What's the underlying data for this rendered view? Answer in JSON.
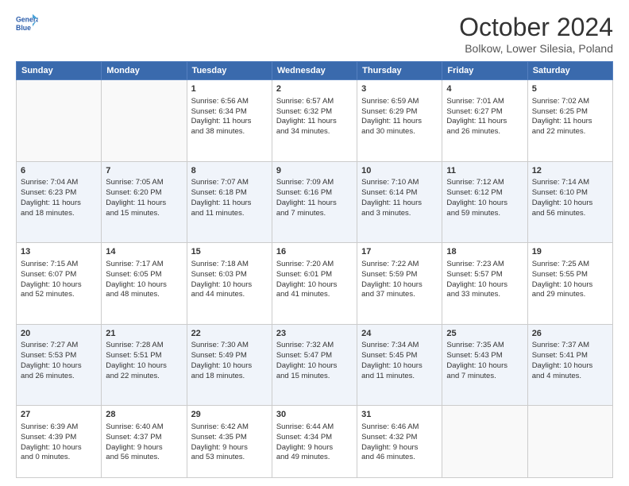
{
  "logo": {
    "line1": "General",
    "line2": "Blue"
  },
  "title": "October 2024",
  "subtitle": "Bolkow, Lower Silesia, Poland",
  "days_header": [
    "Sunday",
    "Monday",
    "Tuesday",
    "Wednesday",
    "Thursday",
    "Friday",
    "Saturday"
  ],
  "weeks": [
    [
      {
        "num": "",
        "info": ""
      },
      {
        "num": "",
        "info": ""
      },
      {
        "num": "1",
        "info": "Sunrise: 6:56 AM\nSunset: 6:34 PM\nDaylight: 11 hours\nand 38 minutes."
      },
      {
        "num": "2",
        "info": "Sunrise: 6:57 AM\nSunset: 6:32 PM\nDaylight: 11 hours\nand 34 minutes."
      },
      {
        "num": "3",
        "info": "Sunrise: 6:59 AM\nSunset: 6:29 PM\nDaylight: 11 hours\nand 30 minutes."
      },
      {
        "num": "4",
        "info": "Sunrise: 7:01 AM\nSunset: 6:27 PM\nDaylight: 11 hours\nand 26 minutes."
      },
      {
        "num": "5",
        "info": "Sunrise: 7:02 AM\nSunset: 6:25 PM\nDaylight: 11 hours\nand 22 minutes."
      }
    ],
    [
      {
        "num": "6",
        "info": "Sunrise: 7:04 AM\nSunset: 6:23 PM\nDaylight: 11 hours\nand 18 minutes."
      },
      {
        "num": "7",
        "info": "Sunrise: 7:05 AM\nSunset: 6:20 PM\nDaylight: 11 hours\nand 15 minutes."
      },
      {
        "num": "8",
        "info": "Sunrise: 7:07 AM\nSunset: 6:18 PM\nDaylight: 11 hours\nand 11 minutes."
      },
      {
        "num": "9",
        "info": "Sunrise: 7:09 AM\nSunset: 6:16 PM\nDaylight: 11 hours\nand 7 minutes."
      },
      {
        "num": "10",
        "info": "Sunrise: 7:10 AM\nSunset: 6:14 PM\nDaylight: 11 hours\nand 3 minutes."
      },
      {
        "num": "11",
        "info": "Sunrise: 7:12 AM\nSunset: 6:12 PM\nDaylight: 10 hours\nand 59 minutes."
      },
      {
        "num": "12",
        "info": "Sunrise: 7:14 AM\nSunset: 6:10 PM\nDaylight: 10 hours\nand 56 minutes."
      }
    ],
    [
      {
        "num": "13",
        "info": "Sunrise: 7:15 AM\nSunset: 6:07 PM\nDaylight: 10 hours\nand 52 minutes."
      },
      {
        "num": "14",
        "info": "Sunrise: 7:17 AM\nSunset: 6:05 PM\nDaylight: 10 hours\nand 48 minutes."
      },
      {
        "num": "15",
        "info": "Sunrise: 7:18 AM\nSunset: 6:03 PM\nDaylight: 10 hours\nand 44 minutes."
      },
      {
        "num": "16",
        "info": "Sunrise: 7:20 AM\nSunset: 6:01 PM\nDaylight: 10 hours\nand 41 minutes."
      },
      {
        "num": "17",
        "info": "Sunrise: 7:22 AM\nSunset: 5:59 PM\nDaylight: 10 hours\nand 37 minutes."
      },
      {
        "num": "18",
        "info": "Sunrise: 7:23 AM\nSunset: 5:57 PM\nDaylight: 10 hours\nand 33 minutes."
      },
      {
        "num": "19",
        "info": "Sunrise: 7:25 AM\nSunset: 5:55 PM\nDaylight: 10 hours\nand 29 minutes."
      }
    ],
    [
      {
        "num": "20",
        "info": "Sunrise: 7:27 AM\nSunset: 5:53 PM\nDaylight: 10 hours\nand 26 minutes."
      },
      {
        "num": "21",
        "info": "Sunrise: 7:28 AM\nSunset: 5:51 PM\nDaylight: 10 hours\nand 22 minutes."
      },
      {
        "num": "22",
        "info": "Sunrise: 7:30 AM\nSunset: 5:49 PM\nDaylight: 10 hours\nand 18 minutes."
      },
      {
        "num": "23",
        "info": "Sunrise: 7:32 AM\nSunset: 5:47 PM\nDaylight: 10 hours\nand 15 minutes."
      },
      {
        "num": "24",
        "info": "Sunrise: 7:34 AM\nSunset: 5:45 PM\nDaylight: 10 hours\nand 11 minutes."
      },
      {
        "num": "25",
        "info": "Sunrise: 7:35 AM\nSunset: 5:43 PM\nDaylight: 10 hours\nand 7 minutes."
      },
      {
        "num": "26",
        "info": "Sunrise: 7:37 AM\nSunset: 5:41 PM\nDaylight: 10 hours\nand 4 minutes."
      }
    ],
    [
      {
        "num": "27",
        "info": "Sunrise: 6:39 AM\nSunset: 4:39 PM\nDaylight: 10 hours\nand 0 minutes."
      },
      {
        "num": "28",
        "info": "Sunrise: 6:40 AM\nSunset: 4:37 PM\nDaylight: 9 hours\nand 56 minutes."
      },
      {
        "num": "29",
        "info": "Sunrise: 6:42 AM\nSunset: 4:35 PM\nDaylight: 9 hours\nand 53 minutes."
      },
      {
        "num": "30",
        "info": "Sunrise: 6:44 AM\nSunset: 4:34 PM\nDaylight: 9 hours\nand 49 minutes."
      },
      {
        "num": "31",
        "info": "Sunrise: 6:46 AM\nSunset: 4:32 PM\nDaylight: 9 hours\nand 46 minutes."
      },
      {
        "num": "",
        "info": ""
      },
      {
        "num": "",
        "info": ""
      }
    ]
  ]
}
